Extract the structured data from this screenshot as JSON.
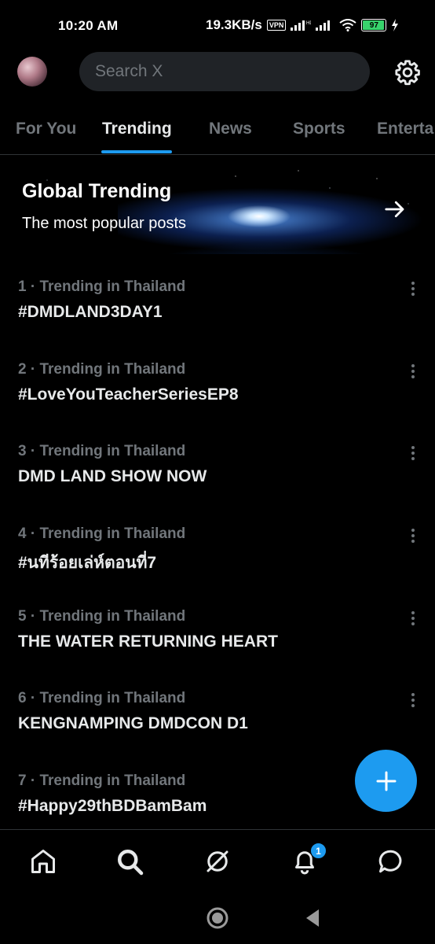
{
  "status_bar": {
    "time": "10:20 AM",
    "speed": "19.3KB/s",
    "vpn": "VPN",
    "battery": "97",
    "battery_level": 0.97,
    "battery_color": "#38d36c"
  },
  "header": {
    "search_placeholder": "Search X",
    "avatar_icon": "user-avatar",
    "settings_icon": "gear-icon"
  },
  "tabs": [
    {
      "label": "For You",
      "active": false
    },
    {
      "label": "Trending",
      "active": true
    },
    {
      "label": "News",
      "active": false
    },
    {
      "label": "Sports",
      "active": false
    },
    {
      "label": "Enterta",
      "active": false
    }
  ],
  "banner": {
    "title": "Global Trending",
    "subtitle": "The most popular posts",
    "icon": "arrow-right-icon"
  },
  "trends": [
    {
      "meta": "1 · Trending in Thailand",
      "name": "#DMDLAND3DAY1"
    },
    {
      "meta": "2 · Trending in Thailand",
      "name": "#LoveYouTeacherSeriesEP8"
    },
    {
      "meta": "3 · Trending in Thailand",
      "name": "DMD LAND SHOW NOW"
    },
    {
      "meta": "4 · Trending in Thailand",
      "name": "#นทีร้อยเล่ห์ตอนที่7"
    },
    {
      "meta": "5 · Trending in Thailand",
      "name": "THE WATER RETURNING HEART"
    },
    {
      "meta": "6 · Trending in Thailand",
      "name": "KENGNAMPING DMDCON D1"
    },
    {
      "meta": "7 · Trending in Thailand",
      "name": "#Happy29thBDBamBam"
    }
  ],
  "bottom_nav": {
    "items": [
      "home-icon",
      "search-icon",
      "grok-icon",
      "notifications-icon",
      "messages-icon"
    ],
    "notification_count": "1"
  },
  "colors": {
    "accent": "#1d9bf0",
    "background": "#000000",
    "text_primary": "#e7e9ea",
    "text_secondary": "#71767b"
  }
}
